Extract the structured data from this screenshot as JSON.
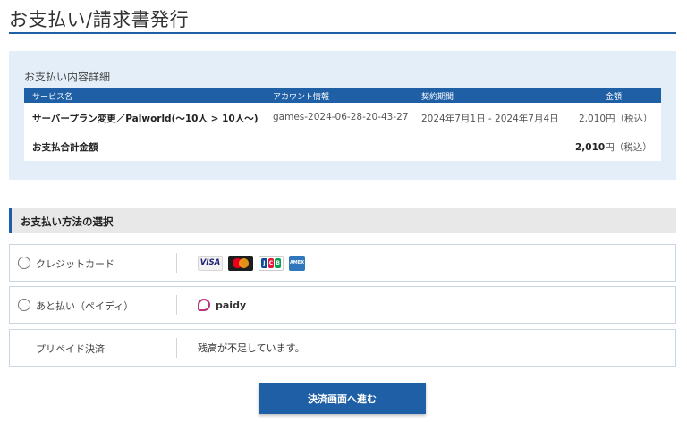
{
  "page": {
    "title": "お支払い/請求書発行"
  },
  "detail": {
    "heading": "お支払い内容詳細",
    "columns": {
      "service": "サービス名",
      "account": "アカウント情報",
      "period": "契約期間",
      "amount": "金額"
    },
    "row": {
      "service": "サーバープラン変更／Palworld(〜10人 > 10人〜)",
      "account": "games-2024-06-28-20-43-27",
      "period": "2024年7月1日 - 2024年7月4日",
      "amount": "2,010円（税込）"
    },
    "total": {
      "label": "お支払合計金額",
      "amount_value": "2,010",
      "amount_suffix": "円（税込）"
    }
  },
  "methods": {
    "heading": "お支払い方法の選択",
    "options": [
      {
        "label": "クレジットカード",
        "cards": [
          "VISA",
          "Mastercard",
          "JCB",
          "AMEX"
        ]
      },
      {
        "label": "あと払い（ペイディ）",
        "brand": "paidy"
      },
      {
        "label": "プリペイド決済",
        "message": "残高が不足しています。"
      }
    ]
  },
  "card_text": {
    "visa": "VISA",
    "jcb_letters": [
      "J",
      "C",
      "B"
    ],
    "amex": "AMEX"
  },
  "colors": {
    "accent": "#1f5fa6",
    "panel_bg": "#e3eef8",
    "paidy": "#b8357a"
  },
  "actions": {
    "proceed_label": "決済画面へ進む"
  }
}
